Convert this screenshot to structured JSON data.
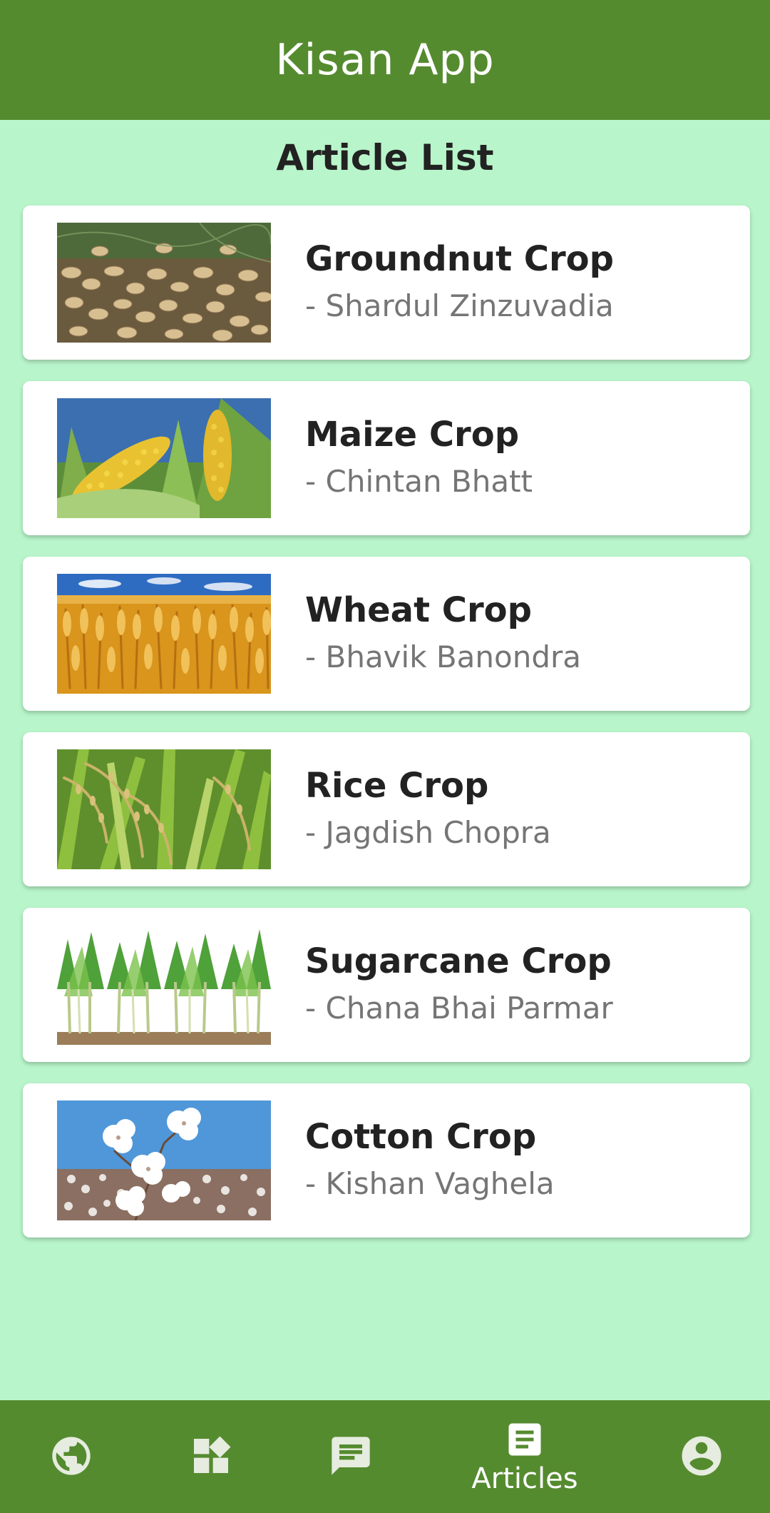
{
  "app": {
    "title": "Kisan App",
    "colors": {
      "primary": "#558b2f",
      "background": "#b8f5ca",
      "card": "#ffffff",
      "title_text": "#222222",
      "author_text": "#757575",
      "nav_icon_inactive": "#e6ecdf"
    }
  },
  "page": {
    "heading": "Article List"
  },
  "articles": [
    {
      "title": "Groundnut Crop",
      "author": "- Shardul Zinzuvadia",
      "image": "groundnut-crop-photo"
    },
    {
      "title": "Maize Crop",
      "author": "- Chintan Bhatt",
      "image": "maize-crop-photo"
    },
    {
      "title": "Wheat Crop",
      "author": "- Bhavik Banondra",
      "image": "wheat-crop-photo"
    },
    {
      "title": "Rice Crop",
      "author": "- Jagdish Chopra",
      "image": "rice-crop-photo"
    },
    {
      "title": "Sugarcane Crop",
      "author": "- Chana Bhai Parmar",
      "image": "sugarcane-crop-photo"
    },
    {
      "title": "Cotton Crop",
      "author": "- Kishan Vaghela",
      "image": "cotton-crop-photo"
    }
  ],
  "bottom_nav": {
    "items": [
      {
        "icon": "globe-icon",
        "label": "",
        "active": false
      },
      {
        "icon": "dashboard-icon",
        "label": "",
        "active": false
      },
      {
        "icon": "chat-icon",
        "label": "",
        "active": false
      },
      {
        "icon": "article-icon",
        "label": "Articles",
        "active": true
      },
      {
        "icon": "account-circle-icon",
        "label": "",
        "active": false
      }
    ]
  }
}
